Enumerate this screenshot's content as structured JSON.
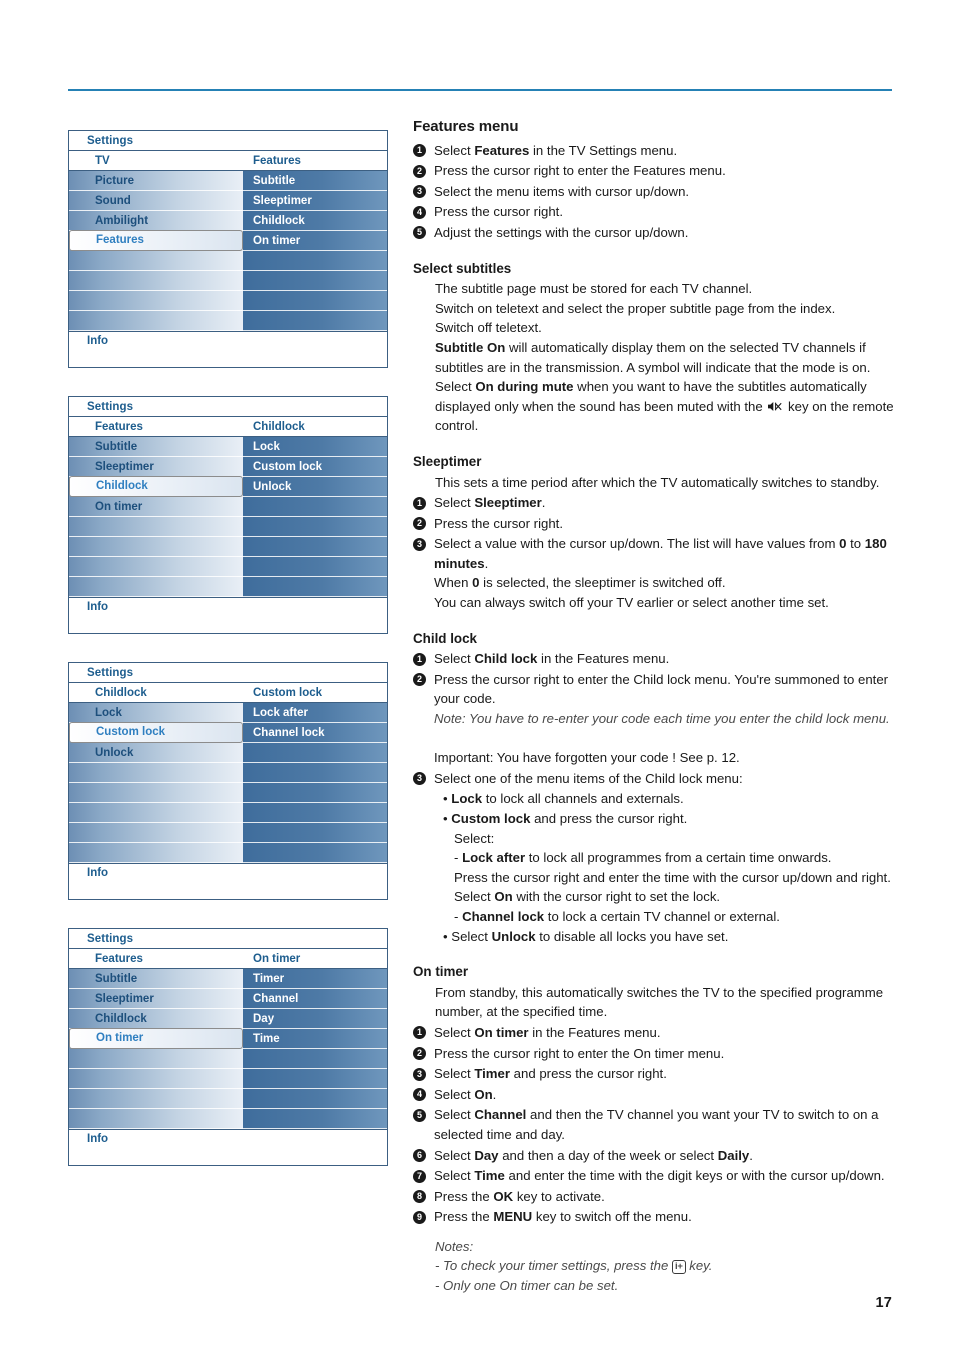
{
  "page": {
    "number": "17",
    "rule_color": "#2581b5"
  },
  "menus": [
    {
      "title": "Settings",
      "breadcrumb_left": "TV",
      "breadcrumb_right": "Features",
      "left_items": [
        "Picture",
        "Sound",
        "Ambilight",
        "Features"
      ],
      "left_selected": "Features",
      "right_items": [
        "Subtitle",
        "Sleeptimer",
        "Childlock",
        "On timer"
      ],
      "footer": "Info"
    },
    {
      "title": "Settings",
      "breadcrumb_left": "Features",
      "breadcrumb_right": "Childlock",
      "left_items": [
        "Subtitle",
        "Sleeptimer",
        "Childlock",
        "On timer"
      ],
      "left_selected": "Childlock",
      "right_items": [
        "Lock",
        "Custom lock",
        "Unlock"
      ],
      "footer": "Info"
    },
    {
      "title": "Settings",
      "breadcrumb_left": "Childlock",
      "breadcrumb_right": "Custom lock",
      "left_items": [
        "Lock",
        "Custom lock",
        "Unlock"
      ],
      "left_selected": "Custom lock",
      "right_items": [
        "Lock after",
        "Channel lock"
      ],
      "footer": "Info"
    },
    {
      "title": "Settings",
      "breadcrumb_left": "Features",
      "breadcrumb_right": "On timer",
      "left_items": [
        "Subtitle",
        "Sleeptimer",
        "Childlock",
        "On timer"
      ],
      "left_selected": "On timer",
      "right_items": [
        "Timer",
        "Channel",
        "Day",
        "Time"
      ],
      "footer": "Info"
    }
  ],
  "content": {
    "features_menu": {
      "heading": "Features menu",
      "steps": [
        {
          "n": "1",
          "html": "Select <b>Features</b> in the TV Settings menu."
        },
        {
          "n": "2",
          "html": "Press the cursor right to enter the Features menu."
        },
        {
          "n": "3",
          "html": "Select the menu items with cursor up/down."
        },
        {
          "n": "4",
          "html": "Press the cursor right."
        },
        {
          "n": "5",
          "html": "Adjust the settings with the cursor up/down."
        }
      ]
    },
    "select_subtitles": {
      "heading": "Select subtitles",
      "paragraph_html": "The subtitle page must be stored for each TV channel.<br>Switch on teletext and select the proper subtitle page from the index.<br>Switch off teletext.<br><b>Subtitle On</b> will automatically display them on the selected TV channels if subtitles are in the transmission. A symbol will indicate that the mode is on.<br>Select <b>On during mute</b> when you want to have the subtitles automatically displayed only when the sound has been muted with the <span class=\"mute-slot\"></span> key on the remote control."
    },
    "sleeptimer": {
      "heading": "Sleeptimer",
      "intro_html": "This sets a time period after which the TV automatically switches to standby.",
      "steps": [
        {
          "n": "1",
          "html": "Select <b>Sleeptimer</b>."
        },
        {
          "n": "2",
          "html": "Press the cursor right."
        },
        {
          "n": "3",
          "html": "Select a value with the cursor up/down. The list will have values from <b>0</b> to <b>180 minutes</b>.<br>When <b>0</b> is selected, the sleeptimer is switched off.<br>You can always switch off your TV earlier or select another time set."
        }
      ]
    },
    "child_lock": {
      "heading": "Child lock",
      "steps": [
        {
          "n": "1",
          "html": "Select <b>Child lock</b> in the Features menu."
        },
        {
          "n": "2",
          "html": "Press the cursor right to enter the Child lock menu. You're summoned to enter your code.<br><span class=\"note\">Note: You have to re-enter your code each time you enter the child lock menu.</span><br><br>Important: You have forgotten your code ! See p. 12."
        },
        {
          "n": "3",
          "html": "Select one of the menu items of the Child lock menu:"
        }
      ],
      "bullets_html": "<div class=\"b\">&bull; <b>Lock</b> to lock all channels and externals.</div><div class=\"b\">&bull; <b>Custom lock</b> and press the cursor right.</div><div class=\"ind\">Select:</div><div class=\"dash\">- <b>Lock after</b> to lock all programmes from a certain time onwards.</div><div class=\"ind\">Press the cursor right and enter the time with the cursor up/down and right. Select <b>On</b> with the cursor right to set the lock.</div><div class=\"dash\">- <b>Channel lock</b> to lock a certain TV channel or external.</div><div class=\"b\">&bull; Select <b>Unlock</b> to disable all locks you have set.</div>"
    },
    "on_timer": {
      "heading": "On timer",
      "intro_html": "From standby, this automatically switches the TV to the specified programme number, at the specified time.",
      "steps": [
        {
          "n": "1",
          "html": "Select <b>On timer</b> in the Features menu."
        },
        {
          "n": "2",
          "html": "Press the cursor right to enter the On timer menu."
        },
        {
          "n": "3",
          "html": "Select <b>Timer</b> and press the cursor right."
        },
        {
          "n": "4",
          "html": "Select <b>On</b>."
        },
        {
          "n": "5",
          "html": "Select <b>Channel</b> and then the TV channel you want your TV to switch to on a selected time and day."
        },
        {
          "n": "6",
          "html": "Select <b>Day</b> and then a day of the week or select <b>Daily</b>."
        },
        {
          "n": "7",
          "html": "Select <b>Time</b> and enter the time with the digit keys or with the cursor up/down."
        },
        {
          "n": "8",
          "html": "Press the <b>OK</b> key to activate."
        },
        {
          "n": "9",
          "html": "Press the <b>MENU</b> key to switch off the menu."
        }
      ],
      "notes_html": "Notes:<br>- To check your timer settings, press the <span class=\"ip-slot\"></span> key.<br>- Only one On timer can be set.",
      "notes_key_label": "i+"
    }
  },
  "icons": {
    "mute": "mute-icon",
    "info_plus": "i+"
  }
}
